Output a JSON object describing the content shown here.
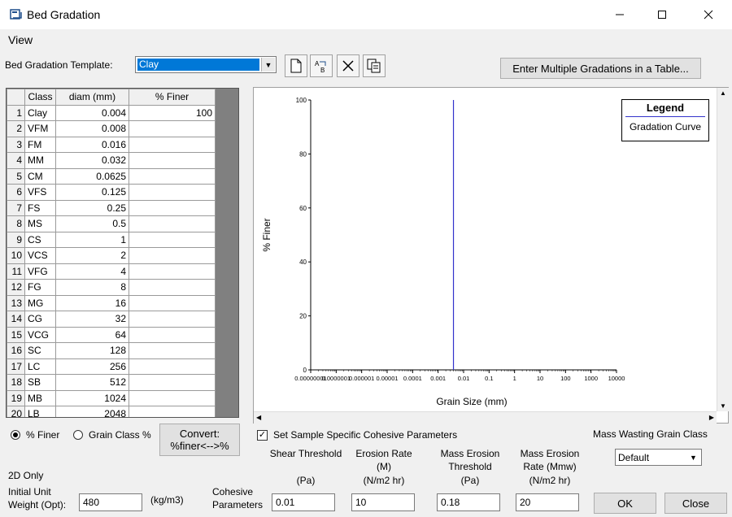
{
  "window": {
    "title": "Bed Gradation"
  },
  "menu": {
    "view": "View"
  },
  "template": {
    "label": "Bed Gradation Template:",
    "selected": "Clay"
  },
  "toolbar": {
    "multi_button": "Enter Multiple Gradations in a Table..."
  },
  "table": {
    "headers": [
      "",
      "Class",
      "diam (mm)",
      "% Finer"
    ],
    "rows": [
      {
        "n": "1",
        "cls": "Clay",
        "diam": "0.004",
        "finer": "100"
      },
      {
        "n": "2",
        "cls": "VFM",
        "diam": "0.008",
        "finer": ""
      },
      {
        "n": "3",
        "cls": "FM",
        "diam": "0.016",
        "finer": ""
      },
      {
        "n": "4",
        "cls": "MM",
        "diam": "0.032",
        "finer": ""
      },
      {
        "n": "5",
        "cls": "CM",
        "diam": "0.0625",
        "finer": ""
      },
      {
        "n": "6",
        "cls": "VFS",
        "diam": "0.125",
        "finer": ""
      },
      {
        "n": "7",
        "cls": "FS",
        "diam": "0.25",
        "finer": ""
      },
      {
        "n": "8",
        "cls": "MS",
        "diam": "0.5",
        "finer": ""
      },
      {
        "n": "9",
        "cls": "CS",
        "diam": "1",
        "finer": ""
      },
      {
        "n": "10",
        "cls": "VCS",
        "diam": "2",
        "finer": ""
      },
      {
        "n": "11",
        "cls": "VFG",
        "diam": "4",
        "finer": ""
      },
      {
        "n": "12",
        "cls": "FG",
        "diam": "8",
        "finer": ""
      },
      {
        "n": "13",
        "cls": "MG",
        "diam": "16",
        "finer": ""
      },
      {
        "n": "14",
        "cls": "CG",
        "diam": "32",
        "finer": ""
      },
      {
        "n": "15",
        "cls": "VCG",
        "diam": "64",
        "finer": ""
      },
      {
        "n": "16",
        "cls": "SC",
        "diam": "128",
        "finer": ""
      },
      {
        "n": "17",
        "cls": "LC",
        "diam": "256",
        "finer": ""
      },
      {
        "n": "18",
        "cls": "SB",
        "diam": "512",
        "finer": ""
      },
      {
        "n": "19",
        "cls": "MB",
        "diam": "1024",
        "finer": ""
      },
      {
        "n": "20",
        "cls": "LB",
        "diam": "2048",
        "finer": ""
      }
    ]
  },
  "chart_data": {
    "type": "line",
    "xlabel": "Grain Size (mm)",
    "ylabel": "% Finer",
    "x_scale": "log",
    "x_ticks": [
      "0.0000001",
      "0.000001",
      "0.00001",
      "0.0001",
      "0.001",
      "0.01",
      "0.1",
      "1",
      "10",
      "100",
      "1000",
      "10000"
    ],
    "x_tick_values": [
      1e-08,
      1e-07,
      1e-06,
      1e-05,
      0.0001,
      0.001,
      0.01,
      0.1,
      1,
      10,
      100,
      1000,
      10000
    ],
    "x_tick_labels_full": [
      "0.00000001",
      "0.0000001",
      "0.000001",
      "0.00001",
      "0.0001",
      "0.001",
      "0.01",
      "0.1",
      "1",
      "10",
      "100",
      "1000",
      "10000"
    ],
    "y_ticks": [
      0,
      20,
      40,
      60,
      80,
      100
    ],
    "ylim": [
      0,
      100
    ],
    "xlim": [
      1e-08,
      10000
    ],
    "series": [
      {
        "name": "Gradation Curve",
        "color": "#3333cc",
        "x": [
          0.004,
          0.004
        ],
        "y": [
          0,
          100
        ]
      }
    ],
    "legend": {
      "title": "Legend",
      "placement": "top-right"
    }
  },
  "radios": {
    "finer": "% Finer",
    "grain_class": "Grain Class %"
  },
  "convert_button": {
    "line1": "Convert:",
    "line2": "%finer<-->%"
  },
  "two_d": {
    "label": "2D Only",
    "unit_weight_label1": "Initial Unit",
    "unit_weight_label2": "Weight (Opt):",
    "unit_weight_value": "480",
    "unit_weight_units": "(kg/m3)"
  },
  "cohesive": {
    "checkbox_label": "Set Sample Specific Cohesive Parameters",
    "params_label1": "Cohesive",
    "params_label2": "Parameters",
    "shear": {
      "l1": "Shear Threshold",
      "l2": "",
      "l3": "(Pa)",
      "value": "0.01"
    },
    "erosion": {
      "l1": "Erosion Rate",
      "l2": "(M)",
      "l3": "(N/m2 hr)",
      "value": "10"
    },
    "mass_threshold": {
      "l1": "Mass Erosion",
      "l2": "Threshold",
      "l3": "(Pa)",
      "value": "0.18"
    },
    "mass_rate": {
      "l1": "Mass Erosion",
      "l2": "Rate (Mmw)",
      "l3": "(N/m2 hr)",
      "value": "20"
    }
  },
  "mass_wasting": {
    "label": "Mass Wasting Grain Class",
    "selected": "Default"
  },
  "buttons": {
    "ok": "OK",
    "close": "Close"
  }
}
